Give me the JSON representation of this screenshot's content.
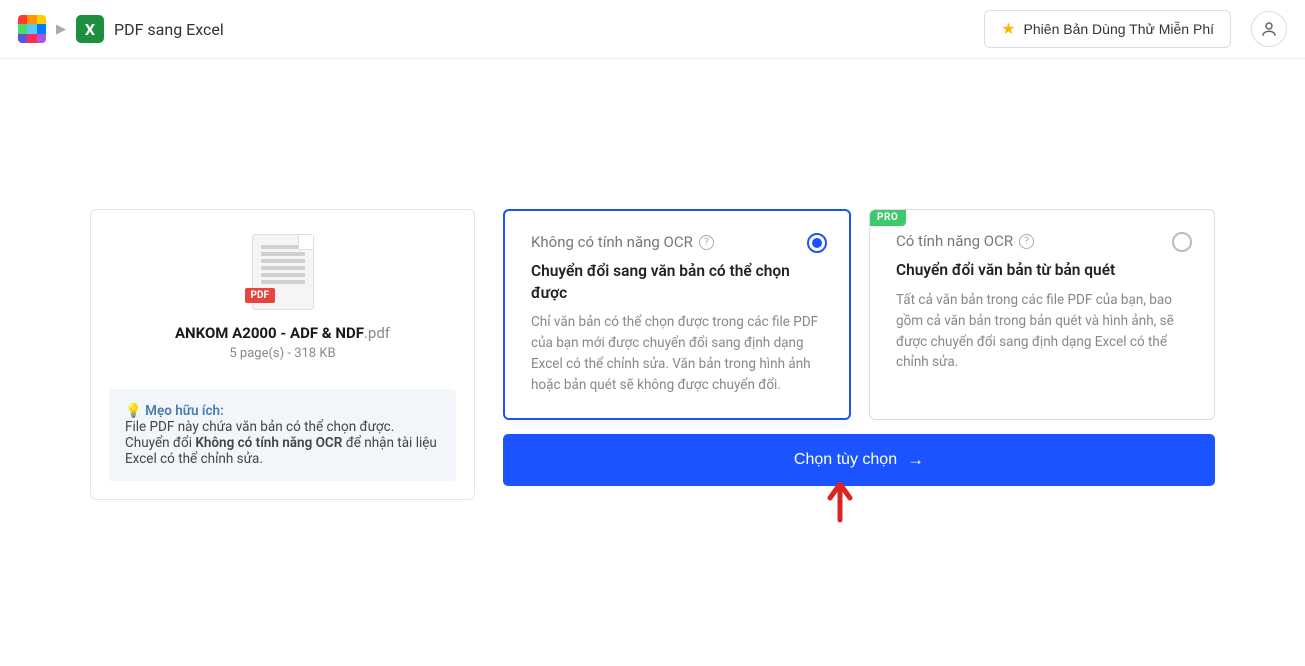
{
  "header": {
    "app_icon_letter": "X",
    "breadcrumb_title": "PDF sang Excel",
    "trial_button": "Phiên Bản Dùng Thử Miễn Phí"
  },
  "file": {
    "name": "ANKOM A2000 - ADF & NDF",
    "ext": ".pdf",
    "badge": "PDF",
    "meta": "5 page(s) - 318 KB"
  },
  "tip": {
    "icon": "💡",
    "title": "Mẹo hữu ích:",
    "line1": "File PDF này chứa văn bản có thể chọn được. Chuyển đổi ",
    "bold": "Không có tính năng OCR",
    "line2": " để nhận tài liệu Excel có thể chỉnh sửa."
  },
  "options": {
    "no_ocr": {
      "head": "Không có tính năng OCR",
      "title": "Chuyển đổi sang văn bản có thể chọn được",
      "desc": "Chỉ văn bản có thể chọn được trong các file PDF của bạn mới được chuyển đổi sang định dạng Excel có thể chỉnh sửa. Văn bản trong hình ảnh hoặc bản quét sẽ không được chuyển đổi."
    },
    "ocr": {
      "pro": "PRO",
      "head": "Có tính năng OCR",
      "title": "Chuyển đổi văn bản từ bản quét",
      "desc": "Tất cả văn bản trong các file PDF của bạn, bao gồm cả văn bản trong bản quét và hình ảnh, sẽ được chuyển đổi sang định dạng Excel có thể chỉnh sửa."
    }
  },
  "cta": "Chọn tùy chọn"
}
